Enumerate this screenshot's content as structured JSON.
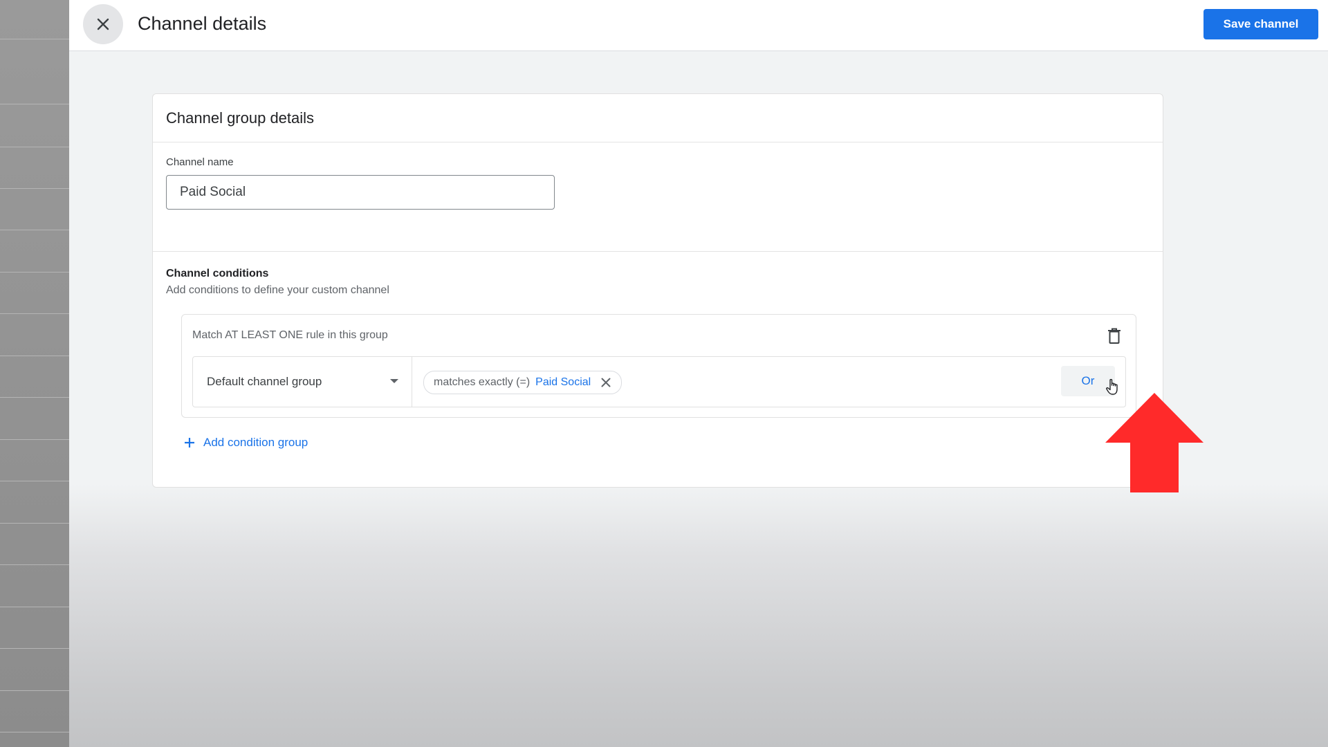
{
  "header": {
    "title": "Channel details",
    "save_label": "Save channel",
    "close_icon": "close-icon"
  },
  "card": {
    "title": "Channel group details",
    "channel_name_label": "Channel name",
    "channel_name_value": "Paid Social",
    "conditions_title": "Channel conditions",
    "conditions_subtitle": "Add conditions to define your custom channel",
    "group": {
      "label": "Match AT LEAST ONE rule in this group",
      "delete_icon": "trash-icon",
      "rule": {
        "dimension": "Default channel group",
        "operator": "matches exactly (=)",
        "value": "Paid Social",
        "or_label": "Or"
      }
    },
    "add_condition_group_label": "Add condition group"
  },
  "colors": {
    "accent": "#1a73e8",
    "annotation_arrow": "#ff2a2a"
  }
}
